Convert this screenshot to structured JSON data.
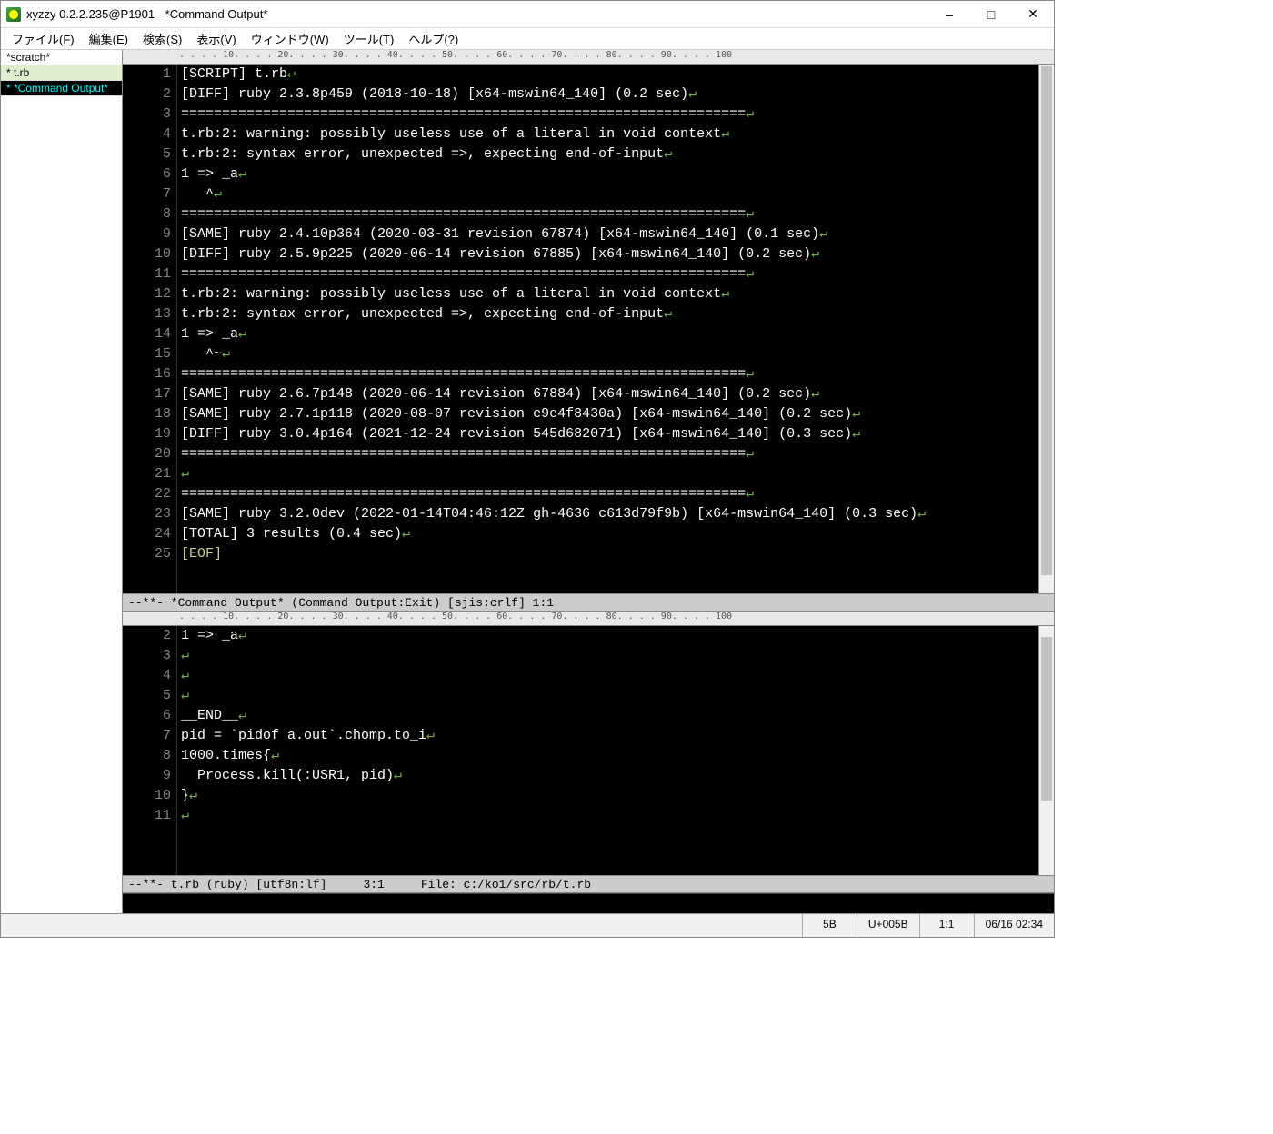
{
  "title": "xyzzy 0.2.2.235@P1901 - *Command Output*",
  "menu": [
    {
      "label": "ファイル",
      "key": "F"
    },
    {
      "label": "編集",
      "key": "E"
    },
    {
      "label": "検索",
      "key": "S"
    },
    {
      "label": "表示",
      "key": "V"
    },
    {
      "label": "ウィンドウ",
      "key": "W"
    },
    {
      "label": "ツール",
      "key": "T"
    },
    {
      "label": "ヘルプ",
      "key": "?"
    }
  ],
  "buffers": [
    {
      "name": "*scratch*",
      "sel": false,
      "active": false
    },
    {
      "name": "* t.rb",
      "sel": true,
      "active": false
    },
    {
      "name": "* *Command Output*",
      "sel": false,
      "active": true
    }
  ],
  "ruler_marks": [
    10,
    20,
    30,
    40,
    50,
    60,
    70,
    80,
    90,
    100
  ],
  "top_pane": {
    "lines": [
      {
        "n": 1,
        "t": "[SCRIPT] t.rb"
      },
      {
        "n": 2,
        "t": "[DIFF] ruby 2.3.8p459 (2018-10-18) [x64-mswin64_140] (0.2 sec)"
      },
      {
        "n": 3,
        "t": "====================================================================="
      },
      {
        "n": 4,
        "t": "t.rb:2: warning: possibly useless use of a literal in void context"
      },
      {
        "n": 5,
        "t": "t.rb:2: syntax error, unexpected =>, expecting end-of-input"
      },
      {
        "n": 6,
        "t": "1 => _a"
      },
      {
        "n": 7,
        "t": "   ^"
      },
      {
        "n": 8,
        "t": "====================================================================="
      },
      {
        "n": 9,
        "t": "[SAME] ruby 2.4.10p364 (2020-03-31 revision 67874) [x64-mswin64_140] (0.1 sec)"
      },
      {
        "n": 10,
        "t": "[DIFF] ruby 2.5.9p225 (2020-06-14 revision 67885) [x64-mswin64_140] (0.2 sec)"
      },
      {
        "n": 11,
        "t": "====================================================================="
      },
      {
        "n": 12,
        "t": "t.rb:2: warning: possibly useless use of a literal in void context"
      },
      {
        "n": 13,
        "t": "t.rb:2: syntax error, unexpected =>, expecting end-of-input"
      },
      {
        "n": 14,
        "t": "1 => _a"
      },
      {
        "n": 15,
        "t": "   ^~"
      },
      {
        "n": 16,
        "t": "====================================================================="
      },
      {
        "n": 17,
        "t": "[SAME] ruby 2.6.7p148 (2020-06-14 revision 67884) [x64-mswin64_140] (0.2 sec)"
      },
      {
        "n": 18,
        "t": "[SAME] ruby 2.7.1p118 (2020-08-07 revision e9e4f8430a) [x64-mswin64_140] (0.2 sec)"
      },
      {
        "n": 19,
        "t": "[DIFF] ruby 3.0.4p164 (2021-12-24 revision 545d682071) [x64-mswin64_140] (0.3 sec)"
      },
      {
        "n": 20,
        "t": "====================================================================="
      },
      {
        "n": 21,
        "t": ""
      },
      {
        "n": 22,
        "t": "====================================================================="
      },
      {
        "n": 23,
        "t": "[SAME] ruby 3.2.0dev (2022-01-14T04:46:12Z gh-4636 c613d79f9b) [x64-mswin64_140] (0.3 sec)"
      },
      {
        "n": 24,
        "t": "[TOTAL] 3 results (0.4 sec)"
      },
      {
        "n": 25,
        "t": "[EOF]",
        "eof": true
      }
    ],
    "modeline": "--**- *Command Output* (Command Output:Exit) [sjis:crlf]           1:1"
  },
  "bot_pane": {
    "lines": [
      {
        "n": 2,
        "t": "1 => _a"
      },
      {
        "n": 3,
        "t": ""
      },
      {
        "n": 4,
        "t": ""
      },
      {
        "n": 5,
        "t": ""
      },
      {
        "n": 6,
        "t": "__END__"
      },
      {
        "n": 7,
        "t": "pid = `pidof a.out`.chomp.to_i"
      },
      {
        "n": 8,
        "t": "1000.times{"
      },
      {
        "n": 9,
        "t": "  Process.kill(:USR1, pid)"
      },
      {
        "n": 10,
        "t": "}"
      },
      {
        "n": 11,
        "t": ""
      }
    ],
    "modeline_left": "--**- t.rb (ruby) [utf8n:lf]",
    "modeline_mid": "3:1",
    "modeline_right": "File: c:/ko1/src/rb/t.rb"
  },
  "status": {
    "a": "5B",
    "b": "U+005B",
    "c": "1:1",
    "d": "06/16 02:34"
  }
}
